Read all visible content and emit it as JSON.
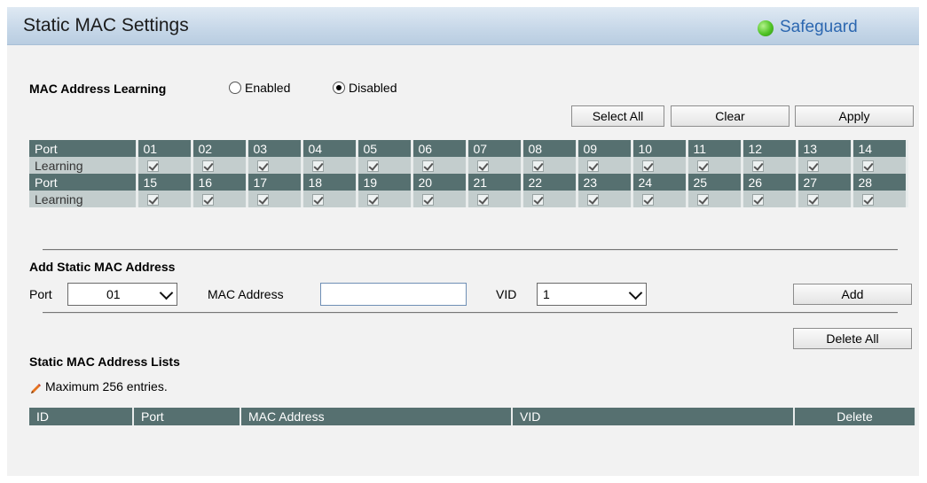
{
  "title": "Static MAC Settings",
  "safeguard": {
    "label": "Safeguard",
    "color": "#4fc325"
  },
  "learning": {
    "label": "MAC Address Learning",
    "options": [
      {
        "label": "Enabled",
        "selected": false
      },
      {
        "label": "Disabled",
        "selected": true
      }
    ]
  },
  "toolbar": {
    "select_all": "Select All",
    "clear": "Clear",
    "apply": "Apply"
  },
  "port_table": {
    "rows": [
      {
        "header": "Port",
        "ports": [
          "01",
          "02",
          "03",
          "04",
          "05",
          "06",
          "07",
          "08",
          "09",
          "10",
          "11",
          "12",
          "13",
          "14"
        ]
      },
      {
        "header": "Learning",
        "checked": [
          true,
          true,
          true,
          true,
          true,
          true,
          true,
          true,
          true,
          true,
          true,
          true,
          true,
          true
        ]
      },
      {
        "header": "Port",
        "ports": [
          "15",
          "16",
          "17",
          "18",
          "19",
          "20",
          "21",
          "22",
          "23",
          "24",
          "25",
          "26",
          "27",
          "28"
        ]
      },
      {
        "header": "Learning",
        "checked": [
          true,
          true,
          true,
          true,
          true,
          true,
          true,
          true,
          true,
          true,
          true,
          true,
          true,
          true
        ]
      }
    ]
  },
  "add_static": {
    "heading": "Add Static MAC Address",
    "port_label": "Port",
    "port_value": "01",
    "mac_label": "MAC Address",
    "mac_value": "",
    "vid_label": "VID",
    "vid_value": "1",
    "add_button": "Add"
  },
  "delete_all": "Delete All",
  "lists": {
    "heading": "Static MAC Address Lists",
    "note": "Maximum 256 entries.",
    "columns": [
      "ID",
      "Port",
      "MAC Address",
      "VID",
      "Delete"
    ]
  },
  "colors": {
    "table_header": "#567070",
    "table_row": "#c3cdcd",
    "title_bar": "#c6d7e8"
  }
}
